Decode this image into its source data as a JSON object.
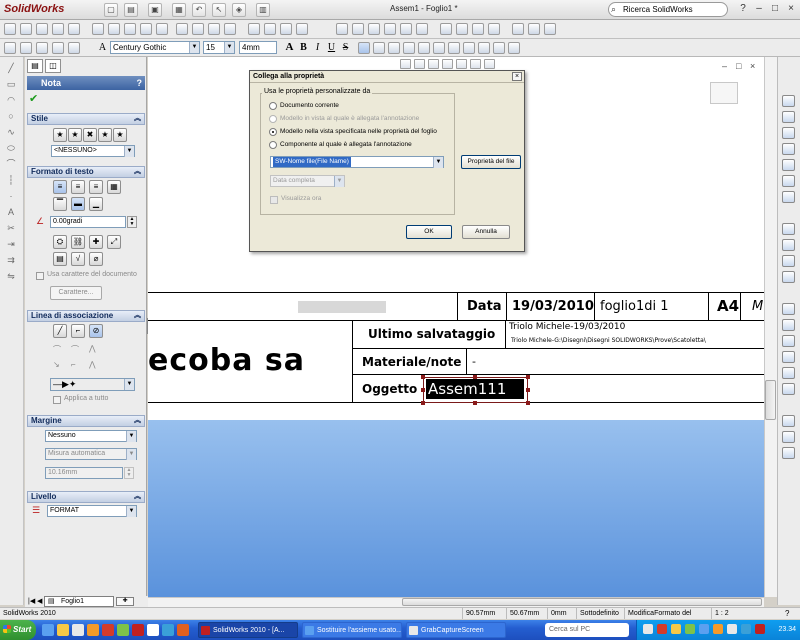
{
  "app": {
    "logo": "SolidWorks",
    "window_title": "Assem1 - Foglio1 *",
    "search_placeholder": "Ricerca SolidWorks",
    "help_label": "?",
    "minimize": "–",
    "restore": "□",
    "close": "×"
  },
  "formatting": {
    "font": "Century Gothic",
    "size": "15",
    "height": "4mm",
    "bold": "B",
    "italic": "I",
    "underline": "U",
    "strike": "S",
    "font_icon": "A"
  },
  "panel": {
    "title": "Nota",
    "help": "?",
    "sections": {
      "stile": {
        "title": "Stile",
        "combo": "<NESSUNO>"
      },
      "formato": {
        "title": "Formato di testo",
        "angle": "0.00gradi",
        "use_doc_font": "Usa carattere del documento",
        "font_button": "Carattere..."
      },
      "linea": {
        "title": "Linea di associazione",
        "apply_all": "Applica a tutto"
      },
      "margine": {
        "title": "Margine",
        "combo1": "Nessuno",
        "combo2": "Misura automatica",
        "value": "10.16mm"
      },
      "livello": {
        "title": "Livello",
        "combo": "FORMAT"
      }
    }
  },
  "title_block": {
    "data_label": "Data",
    "data_value": "19/03/2010",
    "sheet": "foglio1di 1",
    "size": "A4",
    "extra": "M",
    "last_save_label": "Ultimo salvataggio",
    "last_save_value": "Triolo Michele-19/03/2010",
    "last_save_path": "Triolo Michele-G:\\Disegni\\Disegni SOLIDWORKS\\Prove\\Scatoletta\\",
    "material_label": "Materiale/note",
    "material_value": "-",
    "object_label": "Oggetto",
    "object_value": "Assem111",
    "company": "ecoba sa"
  },
  "dialog": {
    "title": "Collega alla proprietà",
    "close": "×",
    "group_title": "Usa le proprietà personalizzate da",
    "options": [
      {
        "label": "Documento corrente",
        "enabled": true,
        "selected": false
      },
      {
        "label": "Modello in vista al quale è allegata l'annotazione",
        "enabled": false,
        "selected": false
      },
      {
        "label": "Modello nella vista specificata nelle proprietà del foglio",
        "enabled": true,
        "selected": true
      },
      {
        "label": "Componente al quale è allegata l'annotazione",
        "enabled": true,
        "selected": false
      }
    ],
    "property_combo": "SW-Nome file(File Name)",
    "date_combo": "Data completa",
    "show_checkbox": "Visualizza ora",
    "file_props_button": "Proprietà del file",
    "ok": "OK",
    "cancel": "Annulla"
  },
  "sheet_tab": "Foglio1",
  "status": {
    "app": "SolidWorks 2010",
    "x": "90.57mm",
    "y": "50.67mm",
    "z": "0mm",
    "state": "Sottodefinito",
    "mode": "ModificaFormato del foglio",
    "scale": "1 : 2"
  },
  "taskbar": {
    "start": "Start",
    "tasks": [
      {
        "label": "SolidWorks 2010 - [A...",
        "active": true
      },
      {
        "label": "Sostituire l'assieme usato...",
        "active": false
      },
      {
        "label": "GrabCaptureScreen",
        "active": false
      }
    ],
    "search_placeholder": "Cerca sul PC",
    "clock": "23.34"
  },
  "colors": {
    "canvas_blue_top": "#98c0ee",
    "canvas_blue_bottom": "#5a92dc",
    "panel_header": "#3c63a2",
    "selected_text_bg": "#000000",
    "taskbar": "#245ed0"
  }
}
